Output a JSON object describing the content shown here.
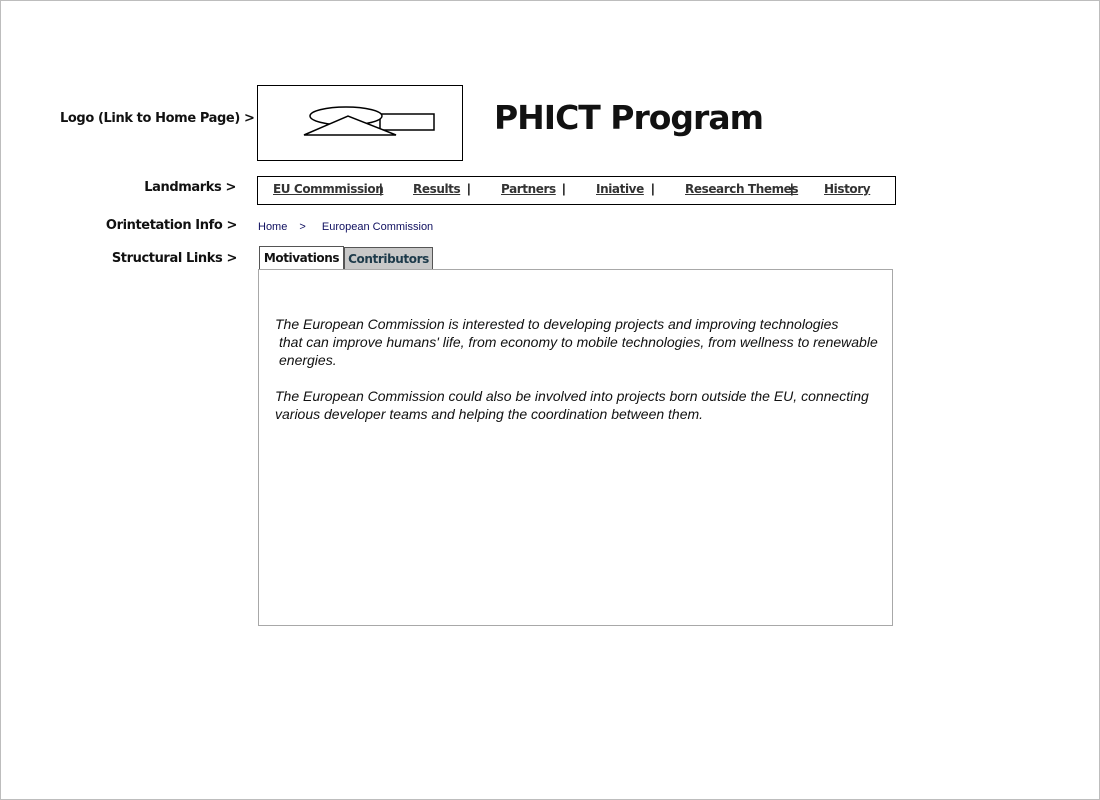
{
  "side_labels": {
    "logo": "Logo (Link to Home Page) >",
    "landmarks": "Landmarks >",
    "orientation": "Orintetation Info >",
    "structural": "Structural Links >"
  },
  "header": {
    "title": "PHICT Program",
    "logo_icon": "placeholder-logo-icon"
  },
  "nav": {
    "items": [
      {
        "label": "EU Commmission"
      },
      {
        "label": "Results"
      },
      {
        "label": "Partners"
      },
      {
        "label": "Iniative"
      },
      {
        "label": "Research Themes"
      },
      {
        "label": "History"
      }
    ],
    "separator": "|"
  },
  "breadcrumb": {
    "home": "Home",
    "separator": ">",
    "current": "European Commission"
  },
  "tabs": [
    {
      "label": "Motivations",
      "active": true
    },
    {
      "label": "Contributors",
      "active": false
    }
  ],
  "content": {
    "paragraph1": {
      "line1": "The European Commission is interested to developing projects and improving technologies",
      "line2": "that can improve humans' life, from economy to mobile technologies, from wellness to renewable",
      "line3": "energies."
    },
    "paragraph2": {
      "line1": "The European Commission could also be involved into projects born outside the EU, connecting",
      "line2": "various developer teams and helping the coordination between them."
    }
  },
  "colors": {
    "breadcrumb_text": "#101060",
    "inactive_tab_bg": "#c8c8c8"
  }
}
